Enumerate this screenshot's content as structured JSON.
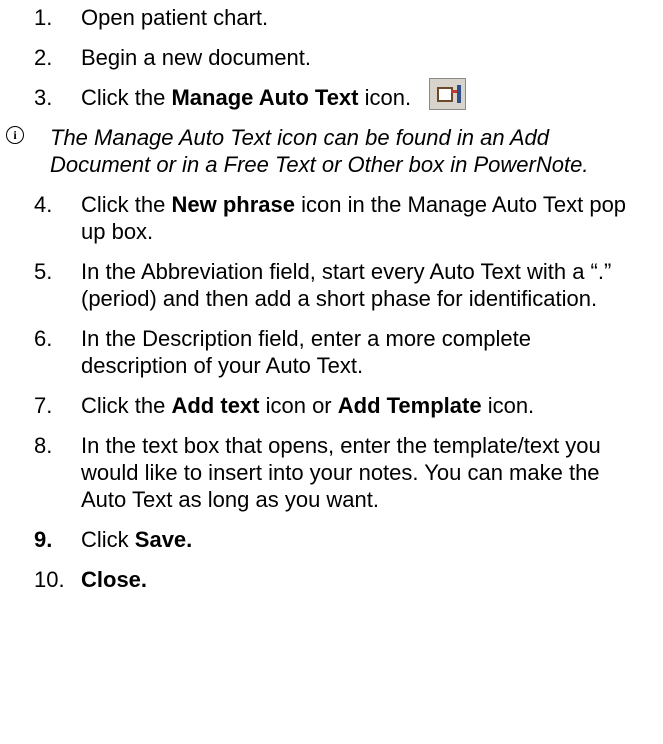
{
  "steps": [
    {
      "n": "1.",
      "parts": [
        {
          "t": "Open patient chart.",
          "b": false
        }
      ]
    },
    {
      "n": "2.",
      "parts": [
        {
          "t": "Begin a new document.",
          "b": false
        }
      ]
    },
    {
      "n": "3.",
      "parts": [
        {
          "t": "Click the ",
          "b": false
        },
        {
          "t": "Manage Auto Text",
          "b": true
        },
        {
          "t": " icon.",
          "b": false
        }
      ]
    },
    {
      "n": "4.",
      "parts": [
        {
          "t": "Click the ",
          "b": false
        },
        {
          "t": "New phrase",
          "b": true
        },
        {
          "t": " icon in the Manage Auto Text pop up box.",
          "b": false
        }
      ]
    },
    {
      "n": "5.",
      "parts": [
        {
          "t": "In the Abbreviation field, start every Auto Text with a “.” (period) and then add a short phase for identification.",
          "b": false
        }
      ]
    },
    {
      "n": "6.",
      "parts": [
        {
          "t": "In the Description field, enter a more complete description of your Auto Text.",
          "b": false
        }
      ]
    },
    {
      "n": "7.",
      "parts": [
        {
          "t": "Click the ",
          "b": false
        },
        {
          "t": "Add text",
          "b": true
        },
        {
          "t": " icon or ",
          "b": false
        },
        {
          "t": "Add Template",
          "b": true
        },
        {
          "t": " icon.",
          "b": false
        }
      ]
    },
    {
      "n": "8.",
      "parts": [
        {
          "t": "In the text box that opens, enter the template/text you would like to insert into your notes. You can make the Auto Text as long as you want.",
          "b": false
        }
      ]
    },
    {
      "n": "9.",
      "bold_num": true,
      "parts": [
        {
          "t": "Click ",
          "b": false
        },
        {
          "t": "Save.",
          "b": true
        }
      ]
    },
    {
      "n": "10.",
      "parts": [
        {
          "t": "Close.",
          "b": true
        }
      ]
    }
  ],
  "note": {
    "icon": "info-icon",
    "text": "The Manage Auto Text icon can be found in an Add Document or in a Free Text or Other box in PowerNote."
  },
  "toolbar_icon": "manage-auto-text-icon"
}
